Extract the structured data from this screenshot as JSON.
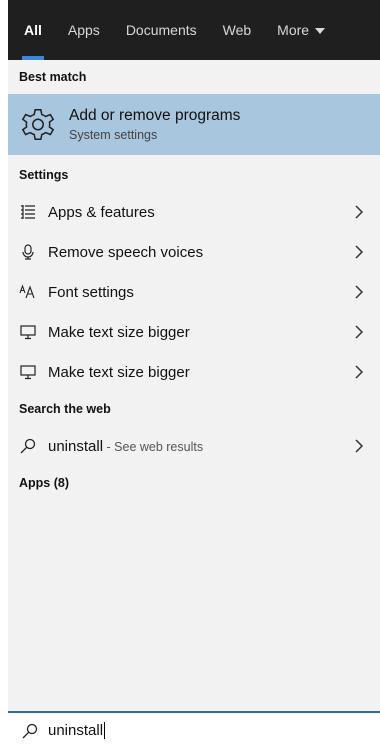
{
  "tabs": [
    {
      "label": "All",
      "active": true
    },
    {
      "label": "Apps",
      "active": false
    },
    {
      "label": "Documents",
      "active": false
    },
    {
      "label": "Web",
      "active": false
    },
    {
      "label": "More",
      "active": false
    }
  ],
  "best_match": {
    "header": "Best match",
    "title": "Add or remove programs",
    "subtitle": "System settings",
    "icon": "gear-icon"
  },
  "settings": {
    "header": "Settings",
    "items": [
      {
        "label": "Apps & features",
        "icon": "list-icon"
      },
      {
        "label": "Remove speech voices",
        "icon": "microphone-icon"
      },
      {
        "label": "Font settings",
        "icon": "font-icon"
      },
      {
        "label": "Make text size bigger",
        "icon": "monitor-icon"
      },
      {
        "label": "Make text size bigger",
        "icon": "monitor-icon"
      }
    ]
  },
  "web": {
    "header": "Search the web",
    "query": "uninstall",
    "suffix": " - See web results"
  },
  "apps": {
    "header": "Apps (8)"
  },
  "search": {
    "value": "uninstall"
  },
  "colors": {
    "tab_bar": "#1f1f1f",
    "tab_accent": "#3a86d8",
    "best_match_bg": "#a8c6dd",
    "panel_bg": "#f2f2f2",
    "search_border": "#2b6cb0"
  }
}
